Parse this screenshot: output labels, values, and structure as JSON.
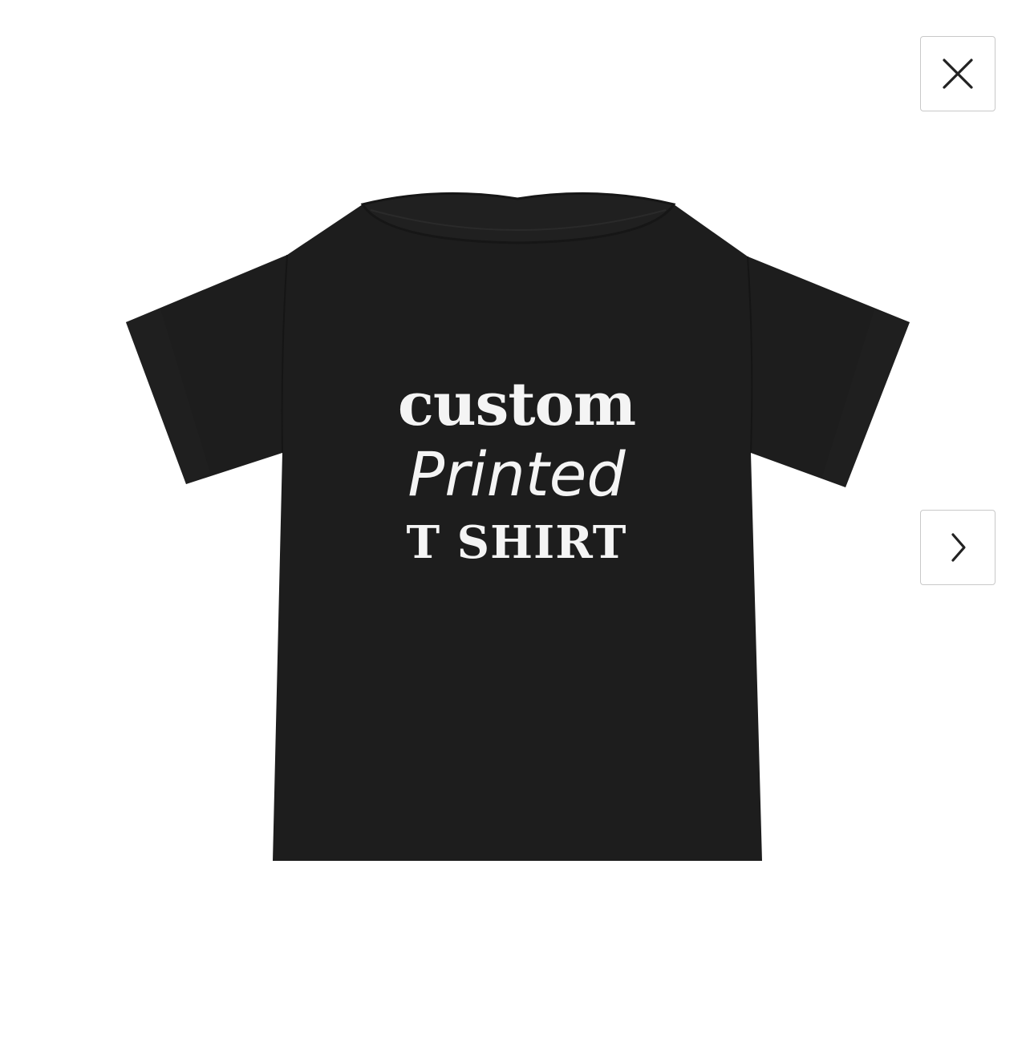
{
  "viewer": {
    "close_icon": "close-icon",
    "next_icon": "chevron-right-icon"
  },
  "product": {
    "shirt_color": "#1d1d1d",
    "print_color": "#f4f4f4",
    "print_lines": [
      "custom",
      "Printed",
      "T SHIRT"
    ]
  }
}
